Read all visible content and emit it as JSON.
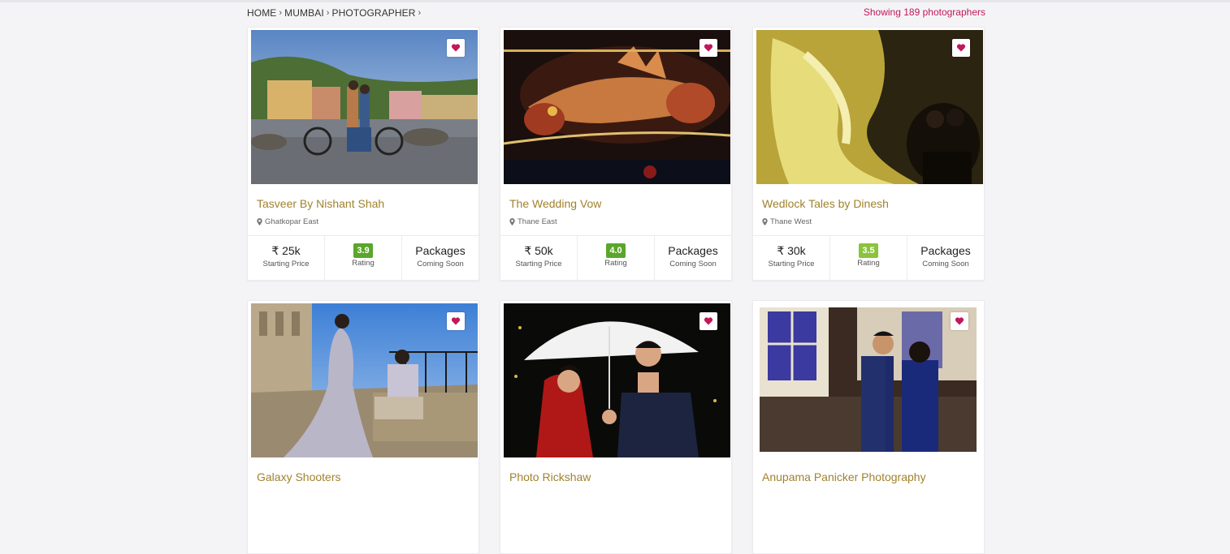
{
  "breadcrumb": [
    "HOME",
    "MUMBAI",
    "PHOTOGRAPHER"
  ],
  "results_count": "Showing 189 photographers",
  "accent_color": "#c2185b",
  "name_color": "#a0822e",
  "rating_color": "#5aa62b",
  "vendors": [
    {
      "name": "Tasveer By Nishant Shah",
      "location": "Ghatkopar East",
      "price": "₹ 25k",
      "price_label": "Starting Price",
      "rating": "3.9",
      "rating_label": "Rating",
      "packages": "Packages",
      "packages_status": "Coming Soon"
    },
    {
      "name": "The Wedding Vow",
      "location": "Thane East",
      "price": "₹ 50k",
      "price_label": "Starting Price",
      "rating": "4.0",
      "rating_label": "Rating",
      "packages": "Packages",
      "packages_status": "Coming Soon"
    },
    {
      "name": "Wedlock Tales by Dinesh",
      "location": "Thane West",
      "price": "₹ 30k",
      "price_label": "Starting Price",
      "rating": "3.5",
      "rating_label": "Rating",
      "packages": "Packages",
      "packages_status": "Coming Soon"
    },
    {
      "name": "Galaxy Shooters"
    },
    {
      "name": "Photo Rickshaw"
    },
    {
      "name": "Anupama Panicker Photography"
    }
  ]
}
